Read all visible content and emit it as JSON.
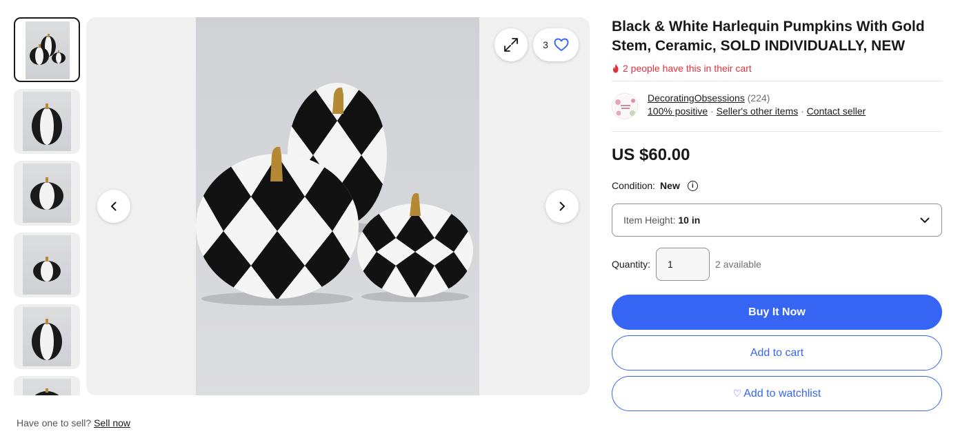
{
  "listing": {
    "title": "Black & White Harlequin Pumpkins With Gold Stem, Ceramic, SOLD INDIVIDUALLY, NEW",
    "cart_note": "2 people have this in their cart",
    "seller": {
      "name": "DecoratingObsessions",
      "feedback_count": "(224)",
      "positive": "100% positive",
      "other_items": "Seller's other items",
      "contact": "Contact seller",
      "separator": "·"
    },
    "price": "US $60.00",
    "condition_label": "Condition:",
    "condition_value": "New",
    "variation_label": "Item Height:",
    "variation_value": "10 in",
    "quantity_label": "Quantity:",
    "quantity_value": "1",
    "available": "2 available",
    "buy_now": "Buy It Now",
    "add_to_cart": "Add to cart",
    "add_to_watchlist": "Add to watchlist"
  },
  "gallery": {
    "watch_count": "3",
    "thumbnail_count": 6,
    "active_thumbnail": 1
  },
  "sell": {
    "prompt": "Have one to sell?",
    "link": "Sell now"
  },
  "colors": {
    "accent_blue": "#3665f3",
    "alert_red": "#e0303a",
    "text": "#191919"
  }
}
